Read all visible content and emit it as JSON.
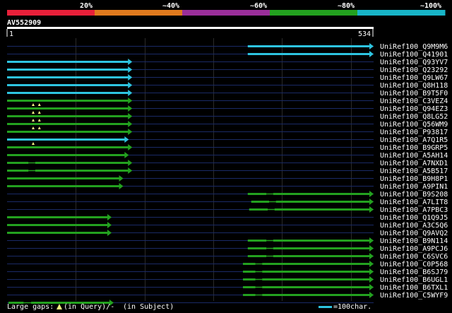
{
  "scale": {
    "labels": [
      "20%",
      "~40%",
      "~60%",
      "~80%",
      "~100%"
    ],
    "band_colors": [
      "#e8203a",
      "#e07a1e",
      "#9a2f9a",
      "#23a11f",
      "#18b5c8"
    ]
  },
  "query": {
    "id": "AV552909",
    "start": "1",
    "end": "534",
    "length": 534
  },
  "legend": {
    "gaps_label": "Large gaps:",
    "query_gap_text": "(in Query)/-",
    "subject_gap_text": "(in Subject)",
    "scale_text": "=100char."
  },
  "hits": [
    {
      "label": "UniRef100_Q9M9M6",
      "color": "#2ec4e0",
      "start": 351,
      "end": 534,
      "gaps": [],
      "marks": []
    },
    {
      "label": "UniRef100_Q41901",
      "color": "#2ec4e0",
      "start": 351,
      "end": 534,
      "gaps": [],
      "marks": []
    },
    {
      "label": "UniRef100_Q93YV7",
      "color": "#2ec4e0",
      "start": 1,
      "end": 183,
      "gaps": [],
      "marks": []
    },
    {
      "label": "UniRef100_Q23292",
      "color": "#2ec4e0",
      "start": 1,
      "end": 183,
      "gaps": [],
      "marks": []
    },
    {
      "label": "UniRef100_Q9LW67",
      "color": "#2ec4e0",
      "start": 1,
      "end": 183,
      "gaps": [],
      "marks": []
    },
    {
      "label": "UniRef100_Q8H118",
      "color": "#2ec4e0",
      "start": 1,
      "end": 183,
      "gaps": [],
      "marks": []
    },
    {
      "label": "UniRef100_B9T5F0",
      "color": "#2ec4e0",
      "start": 1,
      "end": 183,
      "gaps": [],
      "marks": []
    },
    {
      "label": "UniRef100_C3VEZ4",
      "color": "#23a11f",
      "start": 1,
      "end": 183,
      "gaps": [],
      "marks": []
    },
    {
      "label": "UniRef100_Q94EZ3",
      "color": "#23a11f",
      "start": 1,
      "end": 183,
      "gaps": [],
      "marks": [
        39,
        48
      ]
    },
    {
      "label": "UniRef100_Q8LG52",
      "color": "#23a11f",
      "start": 1,
      "end": 183,
      "gaps": [],
      "marks": [
        39,
        48
      ]
    },
    {
      "label": "UniRef100_Q56WM9",
      "color": "#23a11f",
      "start": 1,
      "end": 183,
      "gaps": [],
      "marks": [
        39,
        48
      ]
    },
    {
      "label": "UniRef100_P93817",
      "color": "#23a11f",
      "start": 1,
      "end": 183,
      "gaps": [],
      "marks": [
        39,
        48
      ]
    },
    {
      "label": "UniRef100_A7Q1R5",
      "color": "#2ec4e0",
      "start": 1,
      "end": 178,
      "gaps": [],
      "marks": []
    },
    {
      "label": "UniRef100_B9GRP5",
      "color": "#23a11f",
      "start": 1,
      "end": 183,
      "gaps": [],
      "marks": [
        39
      ]
    },
    {
      "label": "UniRef100_A5AH14",
      "color": "#23a11f",
      "start": 1,
      "end": 178,
      "gaps": [],
      "marks": []
    },
    {
      "label": "UniRef100_A7NXD1",
      "color": "#23a11f",
      "start": 1,
      "end": 183,
      "gaps": [
        [
          32,
          42
        ]
      ],
      "marks": []
    },
    {
      "label": "UniRef100_A5B517",
      "color": "#23a11f",
      "start": 1,
      "end": 183,
      "gaps": [
        [
          32,
          42
        ]
      ],
      "marks": []
    },
    {
      "label": "UniRef100_B9H8P1",
      "color": "#23a11f",
      "start": 1,
      "end": 170,
      "gaps": [],
      "marks": []
    },
    {
      "label": "UniRef100_A9PIN1",
      "color": "#23a11f",
      "start": 1,
      "end": 170,
      "gaps": [],
      "marks": []
    },
    {
      "label": "UniRef100_B9S208",
      "color": "#23a11f",
      "start": 351,
      "end": 534,
      "gaps": [
        [
          378,
          388
        ]
      ],
      "marks": []
    },
    {
      "label": "UniRef100_A7LIT8",
      "color": "#23a11f",
      "start": 356,
      "end": 534,
      "gaps": [
        [
          382,
          392
        ]
      ],
      "marks": []
    },
    {
      "label": "UniRef100_A7PBC3",
      "color": "#23a11f",
      "start": 353,
      "end": 534,
      "gaps": [
        [
          380,
          390
        ]
      ],
      "marks": []
    },
    {
      "label": "UniRef100_Q1Q9J5",
      "color": "#23a11f",
      "start": 1,
      "end": 153,
      "gaps": [],
      "marks": []
    },
    {
      "label": "UniRef100_A3C5Q6",
      "color": "#23a11f",
      "start": 1,
      "end": 153,
      "gaps": [],
      "marks": []
    },
    {
      "label": "UniRef100_Q9AVQ2",
      "color": "#23a11f",
      "start": 1,
      "end": 153,
      "gaps": [],
      "marks": []
    },
    {
      "label": "UniRef100_B9N114",
      "color": "#23a11f",
      "start": 351,
      "end": 534,
      "gaps": [
        [
          378,
          388
        ]
      ],
      "marks": []
    },
    {
      "label": "UniRef100_A9PCJ6",
      "color": "#23a11f",
      "start": 351,
      "end": 534,
      "gaps": [
        [
          378,
          388
        ]
      ],
      "marks": []
    },
    {
      "label": "UniRef100_C6SVC6",
      "color": "#23a11f",
      "start": 351,
      "end": 534,
      "gaps": [
        [
          378,
          388
        ]
      ],
      "marks": []
    },
    {
      "label": "UniRef100_C0P568",
      "color": "#23a11f",
      "start": 344,
      "end": 534,
      "gaps": [
        [
          362,
          372
        ]
      ],
      "marks": []
    },
    {
      "label": "UniRef100_B6SJ79",
      "color": "#23a11f",
      "start": 344,
      "end": 534,
      "gaps": [
        [
          362,
          372
        ]
      ],
      "marks": []
    },
    {
      "label": "UniRef100_B6UGL1",
      "color": "#23a11f",
      "start": 344,
      "end": 534,
      "gaps": [
        [
          362,
          372
        ]
      ],
      "marks": []
    },
    {
      "label": "UniRef100_B6TXL1",
      "color": "#23a11f",
      "start": 344,
      "end": 534,
      "gaps": [
        [
          362,
          372
        ]
      ],
      "marks": []
    },
    {
      "label": "UniRef100_C5WYF9",
      "color": "#23a11f",
      "start": 344,
      "end": 534,
      "gaps": [
        [
          362,
          372
        ]
      ],
      "marks": []
    },
    {
      "label": "",
      "color": "#23a11f",
      "start": 3,
      "end": 156,
      "gaps": [
        [
          25,
          36
        ]
      ],
      "marks": []
    }
  ]
}
